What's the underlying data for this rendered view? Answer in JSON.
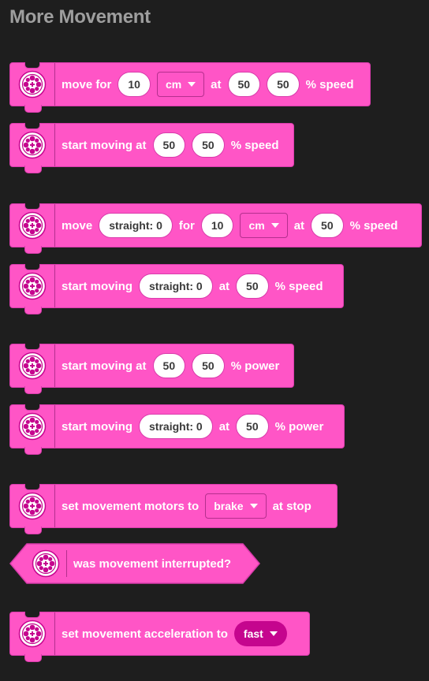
{
  "category_title": "More Movement",
  "icon": "movement-wheel-icon",
  "colors": {
    "block": "#ff55c6",
    "block_border": "#d93bab",
    "dark_dropdown": "#c5058e",
    "background": "#1e1e1e"
  },
  "blocks": {
    "move_for": {
      "t1": "move for",
      "distance": "10",
      "unit": "cm",
      "t2": "at",
      "left_speed": "50",
      "right_speed": "50",
      "t3": "% speed"
    },
    "start_moving_at_speed": {
      "t1": "start moving at",
      "left_speed": "50",
      "right_speed": "50",
      "t2": "% speed"
    },
    "move_steer": {
      "t1": "move",
      "steer": "straight: 0",
      "t2": "for",
      "distance": "10",
      "unit": "cm",
      "t3": "at",
      "speed": "50",
      "t4": "% speed"
    },
    "start_moving_steer_speed": {
      "t1": "start moving",
      "steer": "straight: 0",
      "t2": "at",
      "speed": "50",
      "t3": "% speed"
    },
    "start_moving_at_power": {
      "t1": "start moving at",
      "left_power": "50",
      "right_power": "50",
      "t2": "% power"
    },
    "start_moving_steer_power": {
      "t1": "start moving",
      "steer": "straight: 0",
      "t2": "at",
      "power": "50",
      "t3": "% power"
    },
    "set_motors_stop": {
      "t1": "set movement motors to",
      "action": "brake",
      "t2": "at stop"
    },
    "interrupted": {
      "t1": "was movement interrupted?"
    },
    "set_acceleration": {
      "t1": "set movement acceleration to",
      "value": "fast"
    }
  }
}
